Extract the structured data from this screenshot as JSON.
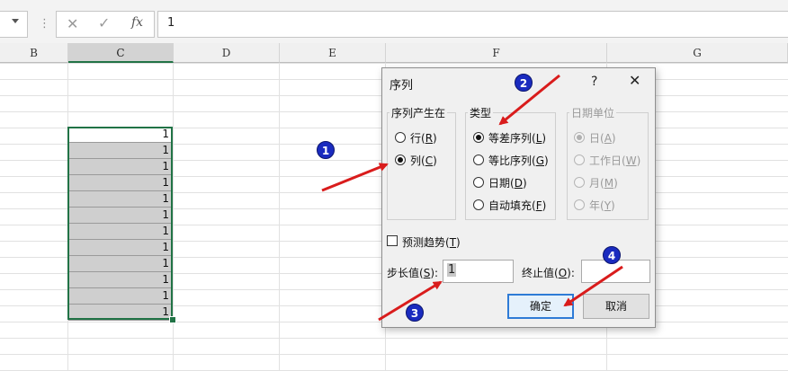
{
  "formula_bar": {
    "dots": "⋮",
    "cancel_glyph": "✕",
    "enter_glyph": "✓",
    "fx_label": "fx",
    "value": "1"
  },
  "columns": [
    "B",
    "C",
    "D",
    "E",
    "F",
    "G"
  ],
  "selected_column": "C",
  "cells": {
    "values": [
      "1",
      "1",
      "1",
      "1",
      "1",
      "1",
      "1",
      "1",
      "1",
      "1",
      "1",
      "1"
    ]
  },
  "dialog": {
    "title": "序列",
    "help": "?",
    "close": "✕",
    "series_in": {
      "label": "序列产生在",
      "options": [
        {
          "text": "行",
          "hotkey": "R",
          "checked": false
        },
        {
          "text": "列",
          "hotkey": "C",
          "checked": true
        }
      ]
    },
    "type": {
      "label": "类型",
      "options": [
        {
          "text": "等差序列",
          "hotkey": "L",
          "checked": true
        },
        {
          "text": "等比序列",
          "hotkey": "G",
          "checked": false
        },
        {
          "text": "日期",
          "hotkey": "D",
          "checked": false
        },
        {
          "text": "自动填充",
          "hotkey": "F",
          "checked": false
        }
      ]
    },
    "date_unit": {
      "label": "日期单位",
      "options": [
        {
          "text": "日",
          "hotkey": "A",
          "checked": true
        },
        {
          "text": "工作日",
          "hotkey": "W",
          "checked": false
        },
        {
          "text": "月",
          "hotkey": "M",
          "checked": false
        },
        {
          "text": "年",
          "hotkey": "Y",
          "checked": false
        }
      ]
    },
    "trend": {
      "text": "预测趋势",
      "hotkey": "T",
      "checked": false
    },
    "step": {
      "label": "步长值",
      "hotkey": "S",
      "value": "1"
    },
    "stop": {
      "label": "终止值",
      "hotkey": "O",
      "value": ""
    },
    "ok_label": "确定",
    "cancel_label": "取消"
  },
  "annotations": [
    "1",
    "2",
    "3",
    "4"
  ],
  "colors": {
    "excel_green": "#217346",
    "badge_blue": "#1a2bbf",
    "arrow_red": "#d91c1c",
    "ok_border": "#2e7bd6"
  }
}
